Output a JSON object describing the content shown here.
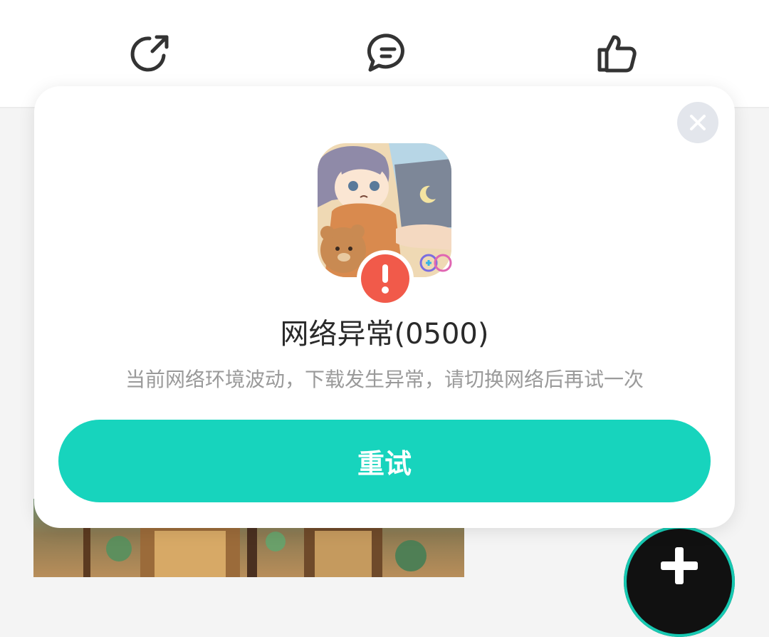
{
  "toolbar": {
    "share_icon": "share-icon",
    "comment_icon": "comment-icon",
    "like_icon": "thumbs-up-icon"
  },
  "dialog": {
    "title": "网络异常(0500)",
    "message": "当前网络环境波动，下载发生异常，请切换网络后再试一次",
    "retry_label": "重试",
    "close_icon": "close-icon",
    "error_icon": "exclamation-icon"
  },
  "fab": {
    "icon": "plus-icon"
  },
  "colors": {
    "accent": "#17d4bd",
    "error": "#f15a4a",
    "title_text": "#2a2a2a",
    "subtitle_text": "#9a9a9a"
  }
}
